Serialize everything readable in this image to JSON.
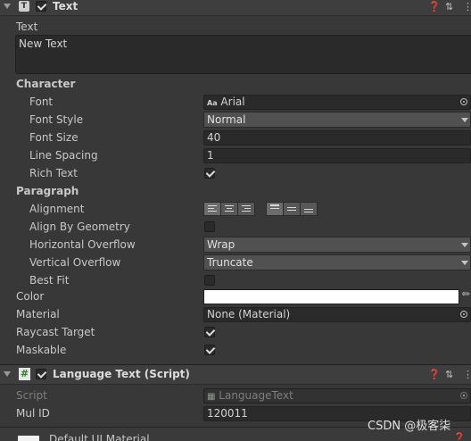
{
  "text_component": {
    "title": "Text",
    "text_label": "Text",
    "text_value": "New Text",
    "character_section": "Character",
    "font_label": "Font",
    "font_value": "Arial",
    "font_icon_glyph": "Aa",
    "font_style_label": "Font Style",
    "font_style_value": "Normal",
    "font_size_label": "Font Size",
    "font_size_value": "40",
    "line_spacing_label": "Line Spacing",
    "line_spacing_value": "1",
    "rich_text_label": "Rich Text",
    "rich_text_checked": true,
    "paragraph_section": "Paragraph",
    "alignment_label": "Alignment",
    "align_by_geometry_label": "Align By Geometry",
    "horizontal_overflow_label": "Horizontal Overflow",
    "horizontal_overflow_value": "Wrap",
    "vertical_overflow_label": "Vertical Overflow",
    "vertical_overflow_value": "Truncate",
    "best_fit_label": "Best Fit",
    "color_label": "Color",
    "color_value": "#ffffff",
    "material_label": "Material",
    "material_value": "None (Material)",
    "raycast_label": "Raycast Target",
    "maskable_label": "Maskable"
  },
  "language_component": {
    "title": "Language Text (Script)",
    "script_label": "Script",
    "script_value": "LanguageText",
    "mul_id_label": "Mul ID",
    "mul_id_value": "120011"
  },
  "material_footer": {
    "title": "Default UI Material"
  },
  "watermark": "CSDN @极客柒"
}
